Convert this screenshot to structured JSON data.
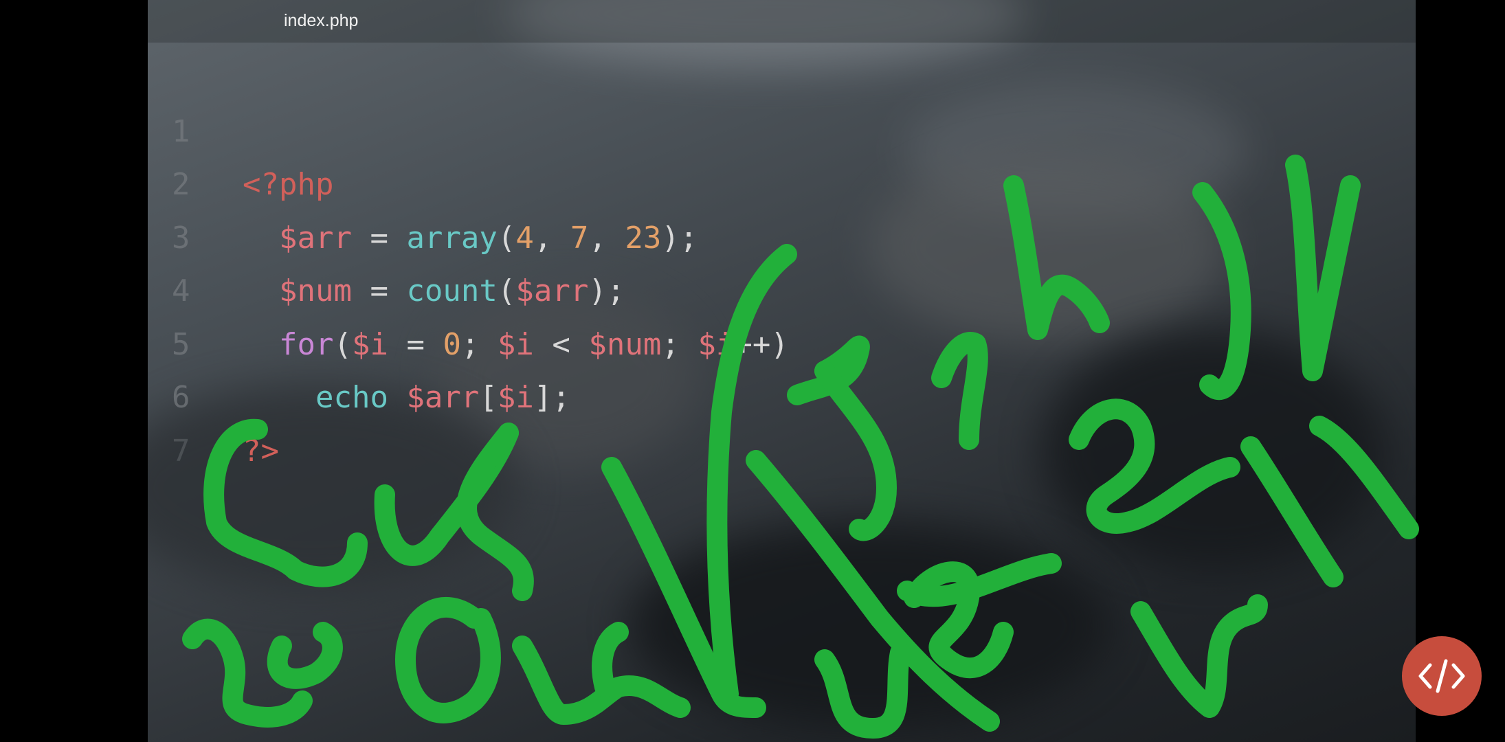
{
  "editor": {
    "tab_title": "index.php",
    "line_numbers": [
      "1",
      "2",
      "3",
      "4",
      "5",
      "6",
      "7"
    ],
    "code": {
      "l1": {
        "open_tag": "<?php"
      },
      "l2": {
        "var": "$arr",
        "eq": " = ",
        "fn": "array",
        "p1": "(",
        "n1": "4",
        "c1": ", ",
        "n2": "7",
        "c2": ", ",
        "n3": "23",
        "end": ");"
      },
      "l3": {
        "var": "$num",
        "eq": " = ",
        "fn": "count",
        "p1": "(",
        "arg": "$arr",
        "end": ");"
      },
      "l4": {
        "kw": "for",
        "p1": "(",
        "v1": "$i",
        "eq": " = ",
        "n0": "0",
        "s1": "; ",
        "v2": "$i",
        "lt": " < ",
        "v3": "$num",
        "s2": "; ",
        "v4": "$i",
        "end": "++)"
      },
      "l5": {
        "fn": "echo",
        "sp": " ",
        "var": "$arr",
        "b1": "[",
        "idx": "$i",
        "end": "];"
      },
      "l6": {
        "close_tag": "?>"
      }
    }
  },
  "annotation": {
    "ink_color": "#22b03a"
  },
  "controls": {
    "code_button_icon": "code-brackets-icon",
    "code_button_color": "#c74d3d"
  }
}
